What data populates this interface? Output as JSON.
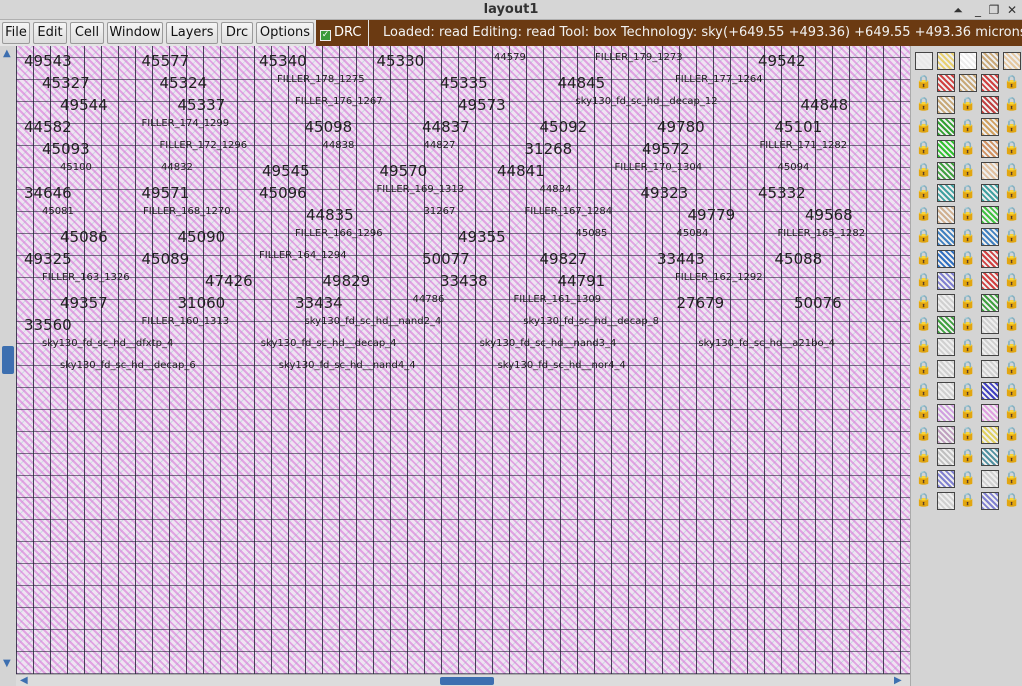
{
  "window": {
    "title": "layout1"
  },
  "menu": {
    "items": [
      "File",
      "Edit",
      "Cell",
      "Window",
      "Layers",
      "Drc",
      "Options"
    ]
  },
  "drc": {
    "label": "DRC",
    "checked": true
  },
  "status": {
    "text": "Loaded: read Editing: read Tool: box  Technology: sky",
    "coords": "(+649.55 +493.36) +649.55 +493.36 microns"
  },
  "canvas": {
    "labels": [
      {
        "t": "49543",
        "big": true
      },
      {
        "t": "45577",
        "big": true
      },
      {
        "t": "45340",
        "big": true
      },
      {
        "t": "45330",
        "big": true
      },
      {
        "t": "44579",
        "big": false
      },
      {
        "t": "FILLER_179_1273",
        "big": false
      },
      {
        "t": "49542",
        "big": true
      },
      {
        "t": "45327",
        "big": true
      },
      {
        "t": "45324",
        "big": true
      },
      {
        "t": "FILLER_178_1275",
        "big": false
      },
      {
        "t": "45335",
        "big": true
      },
      {
        "t": "44845",
        "big": true
      },
      {
        "t": "FILLER_177_1264",
        "big": false
      },
      {
        "t": "49544",
        "big": true
      },
      {
        "t": "45337",
        "big": true
      },
      {
        "t": "FILLER_176_1267",
        "big": false
      },
      {
        "t": "49573",
        "big": true
      },
      {
        "t": "sky130_fd_sc_hd__decap_12",
        "big": false
      },
      {
        "t": "44848",
        "big": true
      },
      {
        "t": "44582",
        "big": true
      },
      {
        "t": "FILLER_174_1299",
        "big": false
      },
      {
        "t": "45098",
        "big": true
      },
      {
        "t": "44837",
        "big": true
      },
      {
        "t": "45092",
        "big": true
      },
      {
        "t": "49780",
        "big": true
      },
      {
        "t": "45101",
        "big": true
      },
      {
        "t": "45093",
        "big": true
      },
      {
        "t": "FILLER_172_1296",
        "big": false
      },
      {
        "t": "44838",
        "big": false
      },
      {
        "t": "44827",
        "big": false
      },
      {
        "t": "31268",
        "big": true
      },
      {
        "t": "49572",
        "big": true
      },
      {
        "t": "FILLER_171_1282",
        "big": false
      },
      {
        "t": "45100",
        "big": false
      },
      {
        "t": "44832",
        "big": false
      },
      {
        "t": "49545",
        "big": true
      },
      {
        "t": "49570",
        "big": true
      },
      {
        "t": "44841",
        "big": true
      },
      {
        "t": "FILLER_170_1304",
        "big": false
      },
      {
        "t": "45094",
        "big": false
      },
      {
        "t": "34646",
        "big": true
      },
      {
        "t": "49571",
        "big": true
      },
      {
        "t": "45096",
        "big": true
      },
      {
        "t": "FILLER_169_1313",
        "big": false
      },
      {
        "t": "44834",
        "big": false
      },
      {
        "t": "49323",
        "big": true
      },
      {
        "t": "45332",
        "big": true
      },
      {
        "t": "45081",
        "big": false
      },
      {
        "t": "FILLER_168_1270",
        "big": false
      },
      {
        "t": "44835",
        "big": true
      },
      {
        "t": "31267",
        "big": false
      },
      {
        "t": "FILLER_167_1284",
        "big": false
      },
      {
        "t": "49779",
        "big": true
      },
      {
        "t": "49568",
        "big": true
      },
      {
        "t": "45086",
        "big": true
      },
      {
        "t": "45090",
        "big": true
      },
      {
        "t": "FILLER_166_1296",
        "big": false
      },
      {
        "t": "49355",
        "big": true
      },
      {
        "t": "45085",
        "big": false
      },
      {
        "t": "45084",
        "big": false
      },
      {
        "t": "FILLER_165_1282",
        "big": false
      },
      {
        "t": "49325",
        "big": true
      },
      {
        "t": "45089",
        "big": true
      },
      {
        "t": "FILLER_164_1294",
        "big": false
      },
      {
        "t": "50077",
        "big": true
      },
      {
        "t": "49827",
        "big": true
      },
      {
        "t": "33443",
        "big": true
      },
      {
        "t": "45088",
        "big": true
      },
      {
        "t": "FILLER_163_1326",
        "big": false
      },
      {
        "t": "47426",
        "big": true
      },
      {
        "t": "49829",
        "big": true
      },
      {
        "t": "33438",
        "big": true
      },
      {
        "t": "44791",
        "big": true
      },
      {
        "t": "FILLER_162_1292",
        "big": false
      },
      {
        "t": "49357",
        "big": true
      },
      {
        "t": "31060",
        "big": true
      },
      {
        "t": "33434",
        "big": true
      },
      {
        "t": "44786",
        "big": false
      },
      {
        "t": "FILLER_161_1309",
        "big": false
      },
      {
        "t": "27679",
        "big": true
      },
      {
        "t": "50076",
        "big": true
      },
      {
        "t": "33560",
        "big": true
      },
      {
        "t": "FILLER_160_1313",
        "big": false
      },
      {
        "t": "sky130_fd_sc_hd__nand2_4",
        "big": false
      },
      {
        "t": "sky130_fd_sc_hd__decap_8",
        "big": false
      },
      {
        "t": "sky130_fd_sc_hd__dfxtp_4",
        "big": false
      },
      {
        "t": "sky130_fd_sc_hd__decap_4",
        "big": false
      },
      {
        "t": "sky130_fd_sc_hd__nand3_4",
        "big": false
      },
      {
        "t": "sky130_fd_sc_hd__a21bo_4",
        "big": false
      },
      {
        "t": "sky130_fd_sc_hd__decap_6",
        "big": false
      },
      {
        "t": "sky130_fd_sc_hd__nand4_4",
        "big": false
      },
      {
        "t": "sky130_fd_sc_hd__nor4_4",
        "big": false
      }
    ]
  },
  "palette": {
    "colors": [
      "#e8e8e8",
      "#e8d070",
      "#ffffff",
      "#c8a878",
      "#e6c8a0",
      "#d04040",
      "#c8a878",
      "#d04040",
      "#c8a878",
      "#c04040",
      "#30a030",
      "#d0a060",
      "#30c030",
      "#d09060",
      "#40a040",
      "#e0c0a0",
      "#40a0a0",
      "#40a0a0",
      "#d0b090",
      "#40c040",
      "#4080c0",
      "#4080c0",
      "#3070c0",
      "#d04040",
      "#8080d0",
      "#d04040",
      "#d0d0d0",
      "#40a040",
      "#40a040",
      "#d0d0d0",
      "#d0d0d0",
      "#d0d0d0",
      "#d0d0d0",
      "#d0d0d0",
      "#d0d0d0",
      "#4040c0",
      "#d0a0e0",
      "#e0a0e0",
      "#c0a0c0",
      "#e0d060",
      "#c0c0c0",
      "#5090a0",
      "#8080d0",
      "#d0d0d0",
      "#d0d0d0",
      "#8080d0",
      "#d0d0d0",
      "#c0a040",
      "#808080"
    ]
  }
}
